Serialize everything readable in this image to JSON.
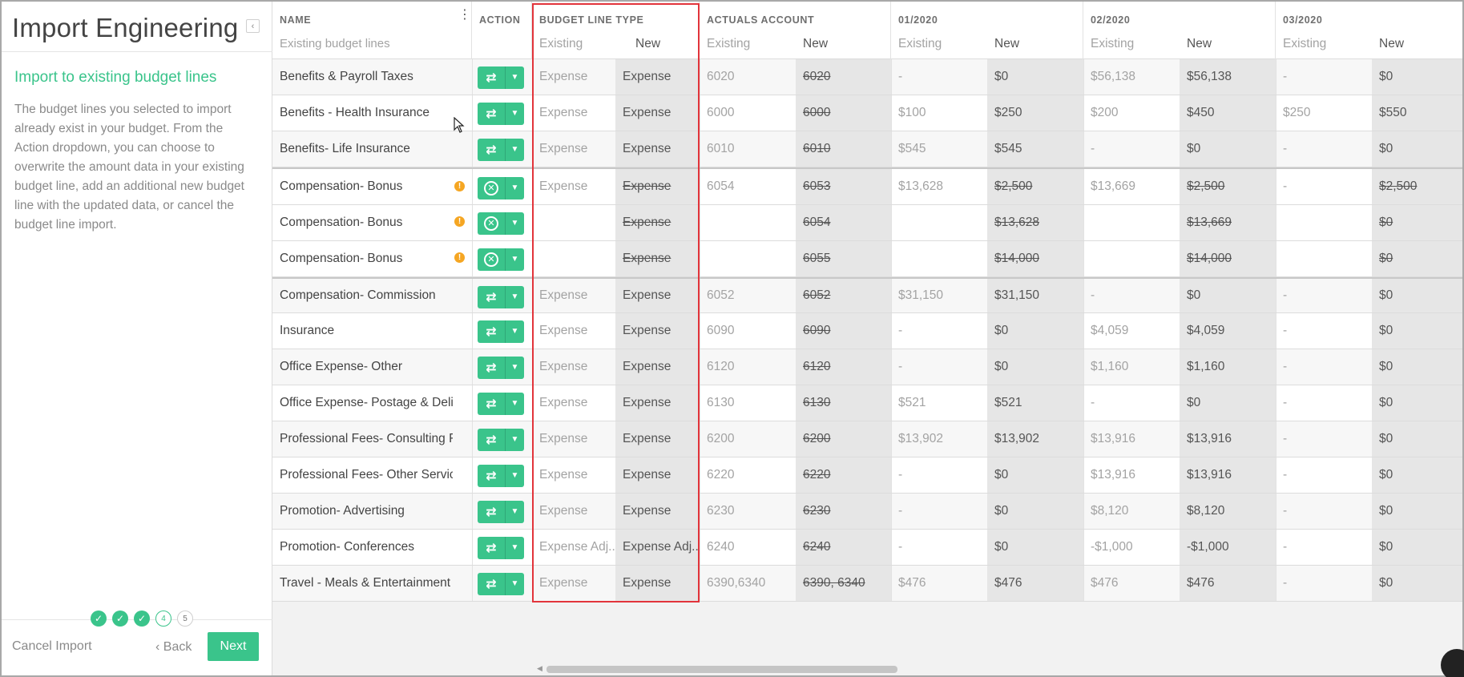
{
  "panel": {
    "title": "Import Engineering",
    "collapse_icon": "‹",
    "step_title": "Import to existing budget lines",
    "step_description": "The budget lines you selected to import already exist in your budget. From the Action dropdown, you can choose to overwrite the amount data in your existing budget line, add an additional new budget line with the updated data, or cancel the budget line import.",
    "steps": [
      {
        "label": "✓",
        "state": "done"
      },
      {
        "label": "✓",
        "state": "done"
      },
      {
        "label": "✓",
        "state": "done"
      },
      {
        "label": "4",
        "state": "current"
      },
      {
        "label": "5",
        "state": "todo"
      }
    ],
    "cancel_label": "Cancel Import",
    "back_label": "‹ Back",
    "next_label": "Next"
  },
  "table": {
    "headers": {
      "name": "NAME",
      "name_sub": "Existing budget lines",
      "action": "ACTION",
      "budget_line_type": "BUDGET LINE TYPE",
      "actuals_account": "ACTUALS ACCOUNT",
      "m1": "01/2020",
      "m2": "02/2020",
      "m3": "03/2020",
      "existing": "Existing",
      "new": "New"
    },
    "rows": [
      {
        "name": "Benefits & Payroll Taxes",
        "action": "overwrite",
        "warn": false,
        "type_ex": "Expense",
        "type_new": "Expense",
        "type_strike": false,
        "acct_ex": "6020",
        "acct_new": "6020",
        "m1_ex": "-",
        "m1_new": "$0",
        "m1_strike": false,
        "m2_ex": "$56,138",
        "m2_new": "$56,138",
        "m2_strike": false,
        "m3_ex": "-",
        "m3_new": "$0",
        "m3_strike": false
      },
      {
        "name": "Benefits - Health Insurance",
        "action": "overwrite",
        "warn": false,
        "type_ex": "Expense",
        "type_new": "Expense",
        "type_strike": false,
        "acct_ex": "6000",
        "acct_new": "6000",
        "m1_ex": "$100",
        "m1_new": "$250",
        "m1_strike": false,
        "m2_ex": "$200",
        "m2_new": "$450",
        "m2_strike": false,
        "m3_ex": "$250",
        "m3_new": "$550",
        "m3_strike": false
      },
      {
        "name": "Benefits- Life Insurance",
        "action": "overwrite",
        "warn": false,
        "type_ex": "Expense",
        "type_new": "Expense",
        "type_strike": false,
        "acct_ex": "6010",
        "acct_new": "6010",
        "m1_ex": "$545",
        "m1_new": "$545",
        "m1_strike": false,
        "m2_ex": "-",
        "m2_new": "$0",
        "m2_strike": false,
        "m3_ex": "-",
        "m3_new": "$0",
        "m3_strike": false
      },
      {
        "name": "Compensation- Bonus",
        "action": "cancel",
        "warn": true,
        "type_ex": "Expense",
        "type_new": "Expense",
        "type_strike": true,
        "acct_ex": "6054",
        "acct_new": "6053",
        "m1_ex": "$13,628",
        "m1_new": "$2,500",
        "m1_strike": true,
        "m2_ex": "$13,669",
        "m2_new": "$2,500",
        "m2_strike": true,
        "m3_ex": "-",
        "m3_new": "$2,500",
        "m3_strike": true
      },
      {
        "name": "Compensation- Bonus",
        "action": "cancel",
        "warn": true,
        "type_ex": "",
        "type_new": "Expense",
        "type_strike": true,
        "acct_ex": "",
        "acct_new": "6054",
        "m1_ex": "",
        "m1_new": "$13,628",
        "m1_strike": true,
        "m2_ex": "",
        "m2_new": "$13,669",
        "m2_strike": true,
        "m3_ex": "",
        "m3_new": "$0",
        "m3_strike": true
      },
      {
        "name": "Compensation- Bonus",
        "action": "cancel",
        "warn": true,
        "type_ex": "",
        "type_new": "Expense",
        "type_strike": true,
        "acct_ex": "",
        "acct_new": "6055",
        "m1_ex": "",
        "m1_new": "$14,000",
        "m1_strike": true,
        "m2_ex": "",
        "m2_new": "$14,000",
        "m2_strike": true,
        "m3_ex": "",
        "m3_new": "$0",
        "m3_strike": true
      },
      {
        "name": "Compensation- Commission",
        "action": "overwrite",
        "warn": false,
        "type_ex": "Expense",
        "type_new": "Expense",
        "type_strike": false,
        "acct_ex": "6052",
        "acct_new": "6052",
        "m1_ex": "$31,150",
        "m1_new": "$31,150",
        "m1_strike": false,
        "m2_ex": "-",
        "m2_new": "$0",
        "m2_strike": false,
        "m3_ex": "-",
        "m3_new": "$0",
        "m3_strike": false
      },
      {
        "name": "Insurance",
        "action": "overwrite",
        "warn": false,
        "type_ex": "Expense",
        "type_new": "Expense",
        "type_strike": false,
        "acct_ex": "6090",
        "acct_new": "6090",
        "m1_ex": "-",
        "m1_new": "$0",
        "m1_strike": false,
        "m2_ex": "$4,059",
        "m2_new": "$4,059",
        "m2_strike": false,
        "m3_ex": "-",
        "m3_new": "$0",
        "m3_strike": false
      },
      {
        "name": "Office Expense- Other",
        "action": "overwrite",
        "warn": false,
        "type_ex": "Expense",
        "type_new": "Expense",
        "type_strike": false,
        "acct_ex": "6120",
        "acct_new": "6120",
        "m1_ex": "-",
        "m1_new": "$0",
        "m1_strike": false,
        "m2_ex": "$1,160",
        "m2_new": "$1,160",
        "m2_strike": false,
        "m3_ex": "-",
        "m3_new": "$0",
        "m3_strike": false
      },
      {
        "name": "Office Expense- Postage & Deliv...",
        "action": "overwrite",
        "warn": false,
        "type_ex": "Expense",
        "type_new": "Expense",
        "type_strike": false,
        "acct_ex": "6130",
        "acct_new": "6130",
        "m1_ex": "$521",
        "m1_new": "$521",
        "m1_strike": false,
        "m2_ex": "-",
        "m2_new": "$0",
        "m2_strike": false,
        "m3_ex": "-",
        "m3_new": "$0",
        "m3_strike": false
      },
      {
        "name": "Professional Fees- Consulting F...",
        "action": "overwrite",
        "warn": false,
        "type_ex": "Expense",
        "type_new": "Expense",
        "type_strike": false,
        "acct_ex": "6200",
        "acct_new": "6200",
        "m1_ex": "$13,902",
        "m1_new": "$13,902",
        "m1_strike": false,
        "m2_ex": "$13,916",
        "m2_new": "$13,916",
        "m2_strike": false,
        "m3_ex": "-",
        "m3_new": "$0",
        "m3_strike": false
      },
      {
        "name": "Professional Fees- Other Servic...",
        "action": "overwrite",
        "warn": false,
        "type_ex": "Expense",
        "type_new": "Expense",
        "type_strike": false,
        "acct_ex": "6220",
        "acct_new": "6220",
        "m1_ex": "-",
        "m1_new": "$0",
        "m1_strike": false,
        "m2_ex": "$13,916",
        "m2_new": "$13,916",
        "m2_strike": false,
        "m3_ex": "-",
        "m3_new": "$0",
        "m3_strike": false
      },
      {
        "name": "Promotion- Advertising",
        "action": "overwrite",
        "warn": false,
        "type_ex": "Expense",
        "type_new": "Expense",
        "type_strike": false,
        "acct_ex": "6230",
        "acct_new": "6230",
        "m1_ex": "-",
        "m1_new": "$0",
        "m1_strike": false,
        "m2_ex": "$8,120",
        "m2_new": "$8,120",
        "m2_strike": false,
        "m3_ex": "-",
        "m3_new": "$0",
        "m3_strike": false
      },
      {
        "name": "Promotion- Conferences",
        "action": "overwrite",
        "warn": false,
        "type_ex": "Expense Adj...",
        "type_new": "Expense Adj...",
        "type_strike": false,
        "acct_ex": "6240",
        "acct_new": "6240",
        "m1_ex": "-",
        "m1_new": "$0",
        "m1_strike": false,
        "m2_ex": "-$1,000",
        "m2_new": "-$1,000",
        "m2_strike": false,
        "m3_ex": "-",
        "m3_new": "$0",
        "m3_strike": false
      },
      {
        "name": "Travel - Meals & Entertainment",
        "action": "overwrite",
        "warn": false,
        "type_ex": "Expense",
        "type_new": "Expense",
        "type_strike": false,
        "acct_ex": "6390,6340",
        "acct_new": "6390, 6340",
        "m1_ex": "$476",
        "m1_new": "$476",
        "m1_strike": false,
        "m2_ex": "$476",
        "m2_new": "$476",
        "m2_strike": false,
        "m3_ex": "-",
        "m3_new": "$0",
        "m3_strike": false
      }
    ]
  },
  "colors": {
    "accent": "#3ac48b",
    "highlight": "#e2343b",
    "warning": "#f5a623"
  }
}
